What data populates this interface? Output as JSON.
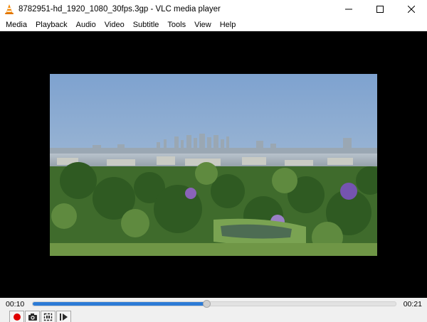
{
  "window": {
    "title": "8782951-hd_1920_1080_30fps.3gp - VLC media player"
  },
  "menu": {
    "items": [
      "Media",
      "Playback",
      "Audio",
      "Video",
      "Subtitle",
      "Tools",
      "View",
      "Help"
    ]
  },
  "playback": {
    "elapsed": "00:10",
    "total": "00:21",
    "progress": 0.48
  },
  "controls": {
    "icons": [
      "record-icon",
      "snapshot-icon",
      "loop-ab-icon",
      "frame-step-icon"
    ]
  },
  "colors": {
    "accent": "#2d7bd6",
    "record": "#e00000",
    "video_bg": "#000000"
  }
}
